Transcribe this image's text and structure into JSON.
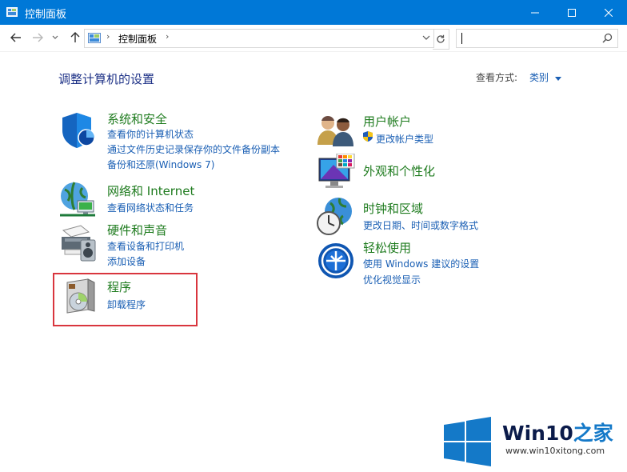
{
  "window": {
    "title": "控制面板"
  },
  "address": {
    "crumb": "控制面板",
    "separator": "›"
  },
  "search": {
    "placeholder": ""
  },
  "header": {
    "heading": "调整计算机的设置",
    "view_by_label": "查看方式:",
    "view_by_value": "类别"
  },
  "left_categories": [
    {
      "title": "系统和安全",
      "links": [
        "查看你的计算机状态",
        "通过文件历史记录保存你的文件备份副本",
        "备份和还原(Windows 7)"
      ],
      "icon": "shield-icon"
    },
    {
      "title": "网络和 Internet",
      "links": [
        "查看网络状态和任务"
      ],
      "icon": "network-globe-icon"
    },
    {
      "title": "硬件和声音",
      "links": [
        "查看设备和打印机",
        "添加设备"
      ],
      "icon": "printer-speaker-icon"
    },
    {
      "title": "程序",
      "links": [
        "卸载程序"
      ],
      "icon": "programs-disc-icon"
    }
  ],
  "right_categories": [
    {
      "title": "用户帐户",
      "links": [
        "更改帐户类型"
      ],
      "icon": "users-icon"
    },
    {
      "title": "外观和个性化",
      "links": [],
      "icon": "monitor-palette-icon"
    },
    {
      "title": "时钟和区域",
      "links": [
        "更改日期、时间或数字格式"
      ],
      "icon": "clock-globe-icon"
    },
    {
      "title": "轻松使用",
      "links": [
        "使用 Windows 建议的设置",
        "优化视觉显示"
      ],
      "icon": "ease-of-access-icon"
    }
  ],
  "watermark": {
    "brand": "Win10",
    "brand_suffix": "之家",
    "url": "www.win10xitong.com"
  },
  "colors": {
    "titlebar": "#0078d7",
    "category_title": "#1e7b1e",
    "link": "#1a5fb4",
    "highlight": "#d9363e"
  }
}
